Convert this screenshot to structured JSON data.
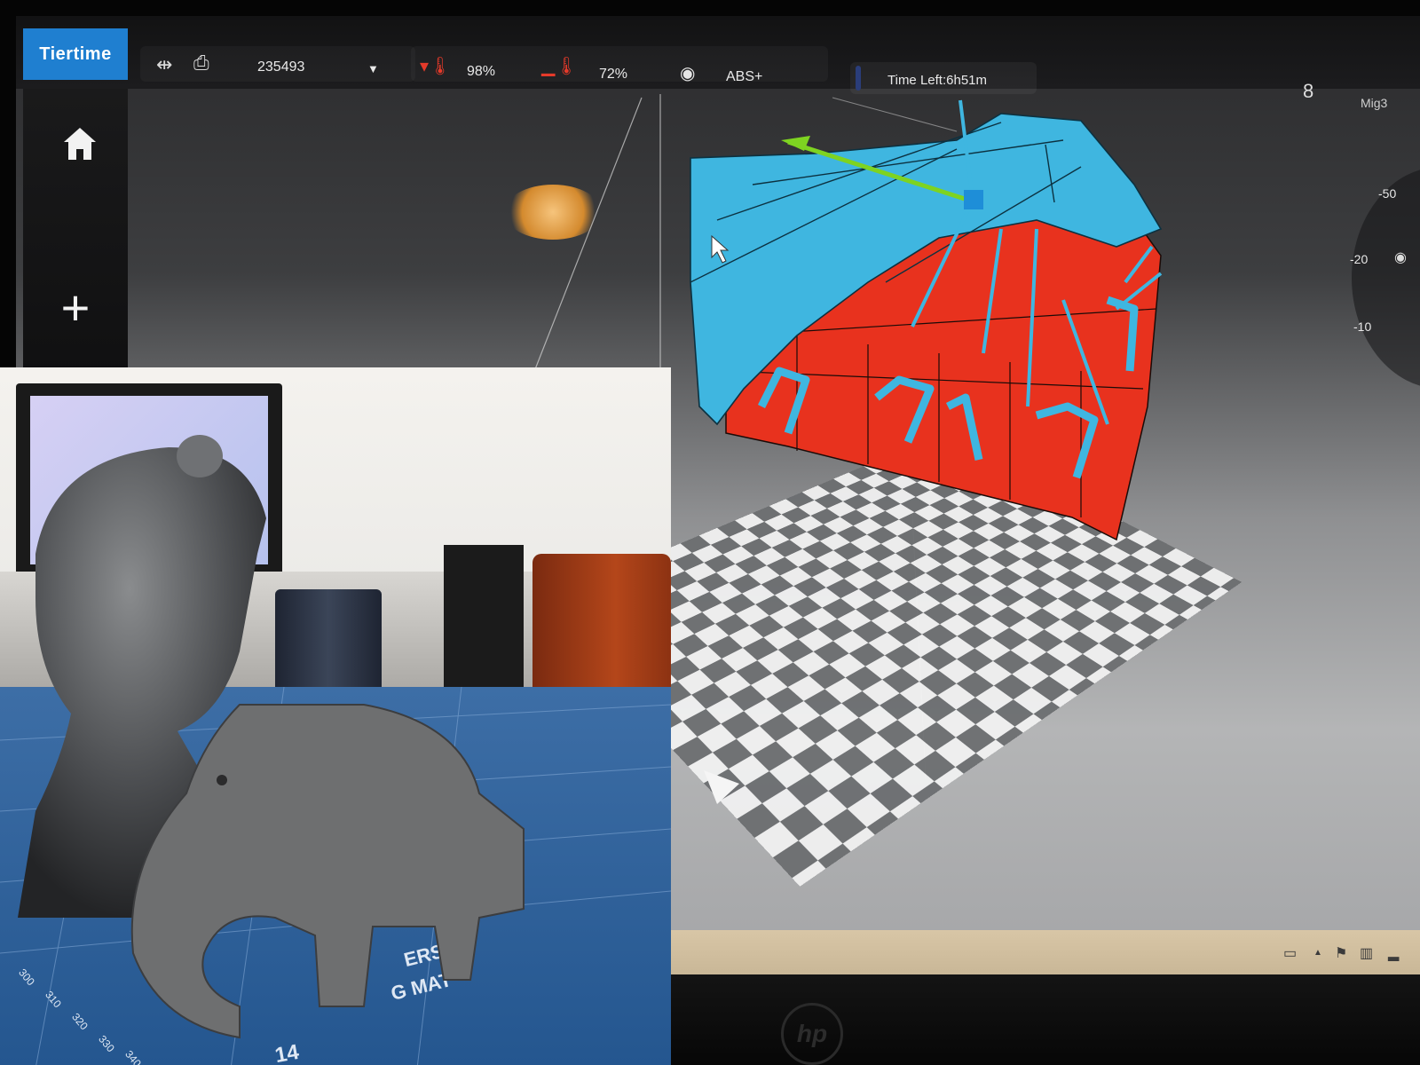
{
  "app": {
    "brand": "Tiertime"
  },
  "toolbar": {
    "usb_icon": "usb-icon",
    "printer_icon": "printer-icon",
    "printer_id": "235493",
    "nozzle_temp_percent": "98%",
    "bed_temp_percent": "72%",
    "material": "ABS+",
    "time_left": "Time Left:6h51m"
  },
  "profile": {
    "name": "Mig3"
  },
  "dial": {
    "ticks": [
      "-50",
      "-20",
      "-10"
    ]
  },
  "colors": {
    "brand_blue": "#1f7fd0",
    "model_red": "#e8321e",
    "support_cyan": "#3fb6e0",
    "axis_green": "#7ed321"
  },
  "inset_photo": {
    "mat_text_1": "ERS",
    "mat_text_2": "G MAT",
    "ruler_numbers": [
      "300",
      "310",
      "320",
      "330",
      "340"
    ],
    "ruler_big": "14"
  },
  "monitor": {
    "brand": "hp"
  }
}
